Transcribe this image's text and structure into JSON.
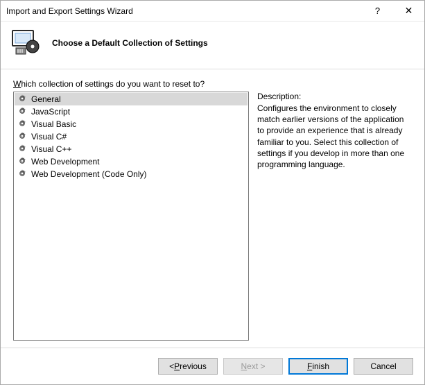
{
  "titlebar": {
    "title": "Import and Export Settings Wizard",
    "help": "?",
    "close": "✕"
  },
  "header": {
    "title": "Choose a Default Collection of Settings"
  },
  "body": {
    "prompt_pre": "W",
    "prompt_rest": "hich collection of settings do you want to reset to?",
    "items": [
      {
        "label": "General",
        "selected": true
      },
      {
        "label": "JavaScript",
        "selected": false
      },
      {
        "label": "Visual Basic",
        "selected": false
      },
      {
        "label": "Visual C#",
        "selected": false
      },
      {
        "label": "Visual C++",
        "selected": false
      },
      {
        "label": "Web Development",
        "selected": false
      },
      {
        "label": "Web Development (Code Only)",
        "selected": false
      }
    ],
    "description_label": "Description:",
    "description_text": "Configures the environment to closely match earlier versions of the application to provide an experience that is already familiar to you. Select this collection of settings if you develop in more than one programming language."
  },
  "footer": {
    "previous_pre": "< ",
    "previous_u": "P",
    "previous_post": "revious",
    "next_u": "N",
    "next_post": "ext >",
    "finish_u": "F",
    "finish_post": "inish",
    "cancel": "Cancel"
  }
}
